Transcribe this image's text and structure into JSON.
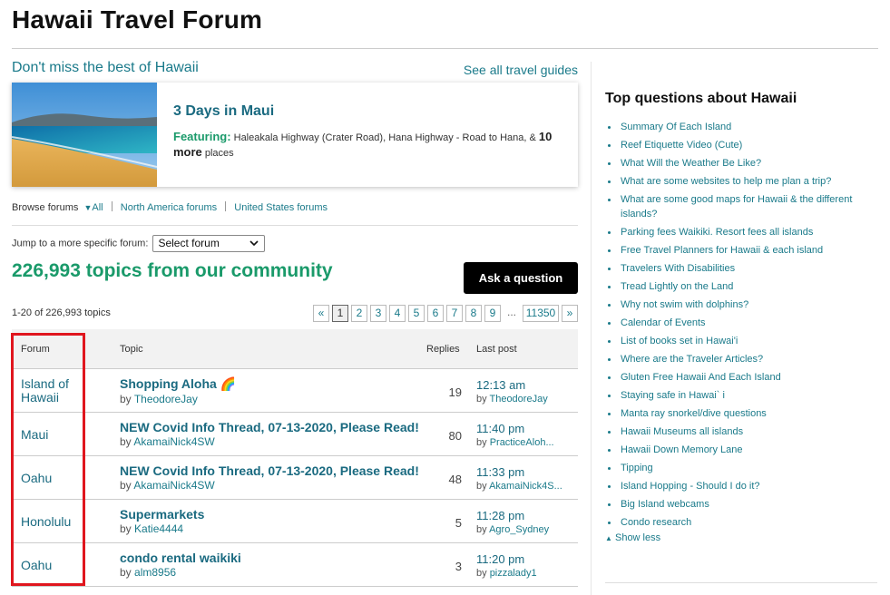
{
  "page": {
    "title": "Hawaii Travel Forum"
  },
  "promo": {
    "heading": "Don't miss the best of Hawaii",
    "see_all": "See all travel guides",
    "guide": {
      "title": "3 Days in Maui",
      "featuring_label": "Featuring:",
      "featuring_text": " Haleakala Highway (Crater Road), Hana Highway - Road to Hana, & ",
      "more_count": "10 more",
      "places": " places"
    }
  },
  "browse": {
    "label": "Browse forums",
    "all": "All",
    "north_america": "North America forums",
    "united_states": "United States forums"
  },
  "jump": {
    "label": "Jump to a more specific forum:",
    "select_value": "Select forum"
  },
  "community": {
    "topics_count": "226,993 topics from our community",
    "ask_button": "Ask a question"
  },
  "list": {
    "range": "1-20 of 226,993 topics",
    "pager": {
      "prev": "«",
      "pages": [
        "1",
        "2",
        "3",
        "4",
        "5",
        "6",
        "7",
        "8",
        "9"
      ],
      "ellipsis": "...",
      "last": "11350",
      "next": "»"
    },
    "headers": {
      "forum": "Forum",
      "topic": "Topic",
      "replies": "Replies",
      "last_post": "Last post"
    },
    "rows": [
      {
        "forum": "Island of Hawaii",
        "topic": "Shopping Aloha 🌈",
        "by": "by",
        "author": "TheodoreJay",
        "replies": "19",
        "time": "12:13 am",
        "last_by": "TheodoreJay"
      },
      {
        "forum": "Maui",
        "topic": "NEW Covid Info Thread, 07-13-2020, Please Read!",
        "by": "by",
        "author": "AkamaiNick4SW",
        "replies": "80",
        "time": "11:40 pm",
        "last_by": "PracticeAloh..."
      },
      {
        "forum": "Oahu",
        "topic": "NEW Covid Info Thread, 07-13-2020, Please Read!",
        "by": "by",
        "author": "AkamaiNick4SW",
        "replies": "48",
        "time": "11:33 pm",
        "last_by": "AkamaiNick4S..."
      },
      {
        "forum": "Honolulu",
        "topic": "Supermarkets",
        "by": "by",
        "author": "Katie4444",
        "replies": "5",
        "time": "11:28 pm",
        "last_by": "Agro_Sydney"
      },
      {
        "forum": "Oahu",
        "topic": "condo rental waikiki",
        "by": "by",
        "author": "alm8956",
        "replies": "3",
        "time": "11:20 pm",
        "last_by": "pizzalady1"
      }
    ]
  },
  "sidebar": {
    "heading": "Top questions about Hawaii",
    "questions": [
      "Summary Of Each Island",
      "Reef Etiquette Video (Cute)",
      "What Will the Weather Be Like?",
      "What are some websites to help me plan a trip?",
      "What are some good maps for Hawaii & the different islands?",
      "Parking fees Waikiki. Resort fees all islands",
      "Free Travel Planners for Hawaii & each island",
      "Travelers With Disabilities",
      "Tread Lightly on the Land",
      "Why not swim with dolphins?",
      "Calendar of Events",
      "List of books set in Hawai'i",
      "Where are the Traveler Articles?",
      "Gluten Free Hawaii And Each Island",
      "Staying safe in Hawai` i",
      "Manta ray snorkel/dive questions",
      "Hawaii Museums all islands",
      "Hawaii Down Memory Lane",
      "Tipping",
      "Island Hopping - Should I do it?",
      "Big Island webcams",
      "Condo research"
    ],
    "show_less": "Show less"
  },
  "colors": {
    "accent": "#1a7a8a",
    "green": "#1a9a6a",
    "highlight": "#e0161e"
  }
}
